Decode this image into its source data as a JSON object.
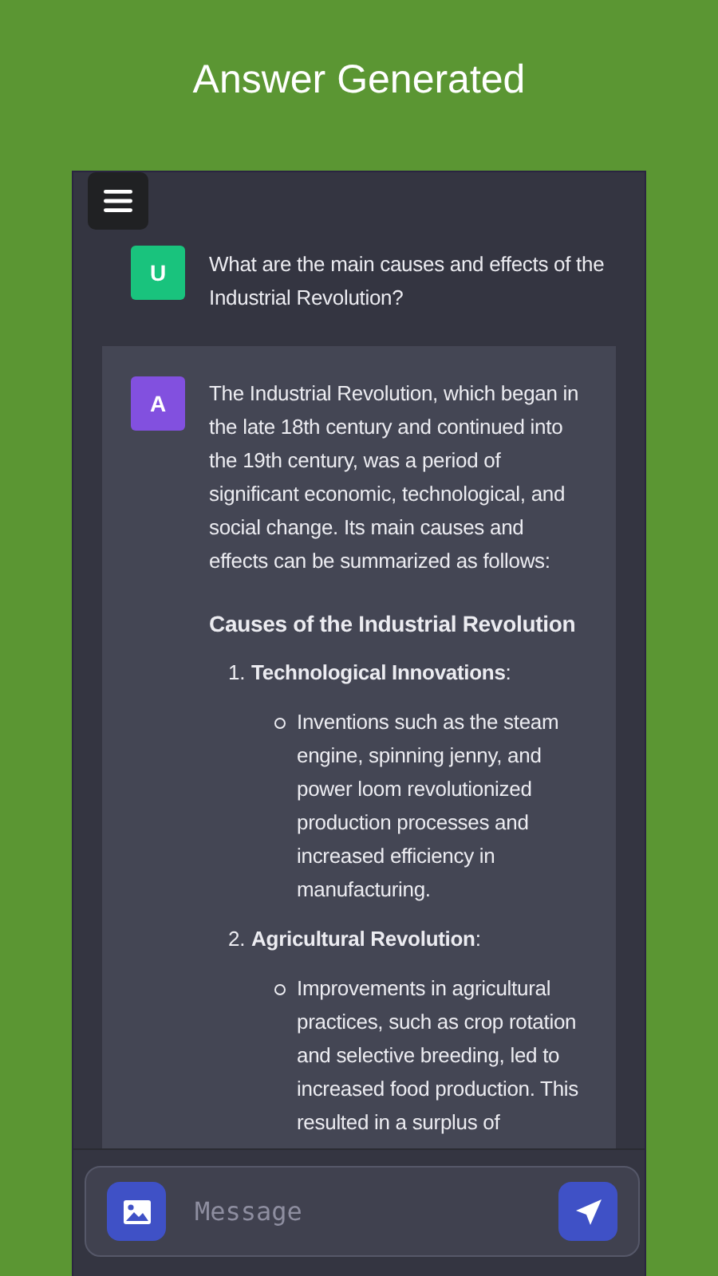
{
  "header": {
    "title": "Answer Generated"
  },
  "chat": {
    "messages": [
      {
        "kind": "user",
        "avatar": "U",
        "text": "What are the main causes and effects of the Industrial Revolution?"
      },
      {
        "kind": "assistant",
        "avatar": "A",
        "blocks": [
          {
            "kind": "paragraph",
            "text": "The Industrial Revolution, which began in the late 18th century and continued into the 19th century, was a period of significant economic, technological, and social change. Its main causes and effects can be summarized as follows:"
          },
          {
            "kind": "heading",
            "text": "Causes of the Industrial Revolution"
          },
          {
            "kind": "ordered_list",
            "items": [
              {
                "number": "1.",
                "text": "**Technological Innovations**:",
                "bullets": [
                  "Inventions such as the steam engine, spinning jenny, and power loom revolutionized production processes and increased efficiency in manufacturing."
                ]
              },
              {
                "number": "2.",
                "text": "**Agricultural Revolution**:",
                "bullets": [
                  "Improvements in agricultural practices, such as crop rotation and selective breeding, led to increased food production. This resulted in a surplus of"
                ]
              }
            ]
          }
        ]
      }
    ]
  },
  "composer": {
    "placeholder": "Message"
  }
}
